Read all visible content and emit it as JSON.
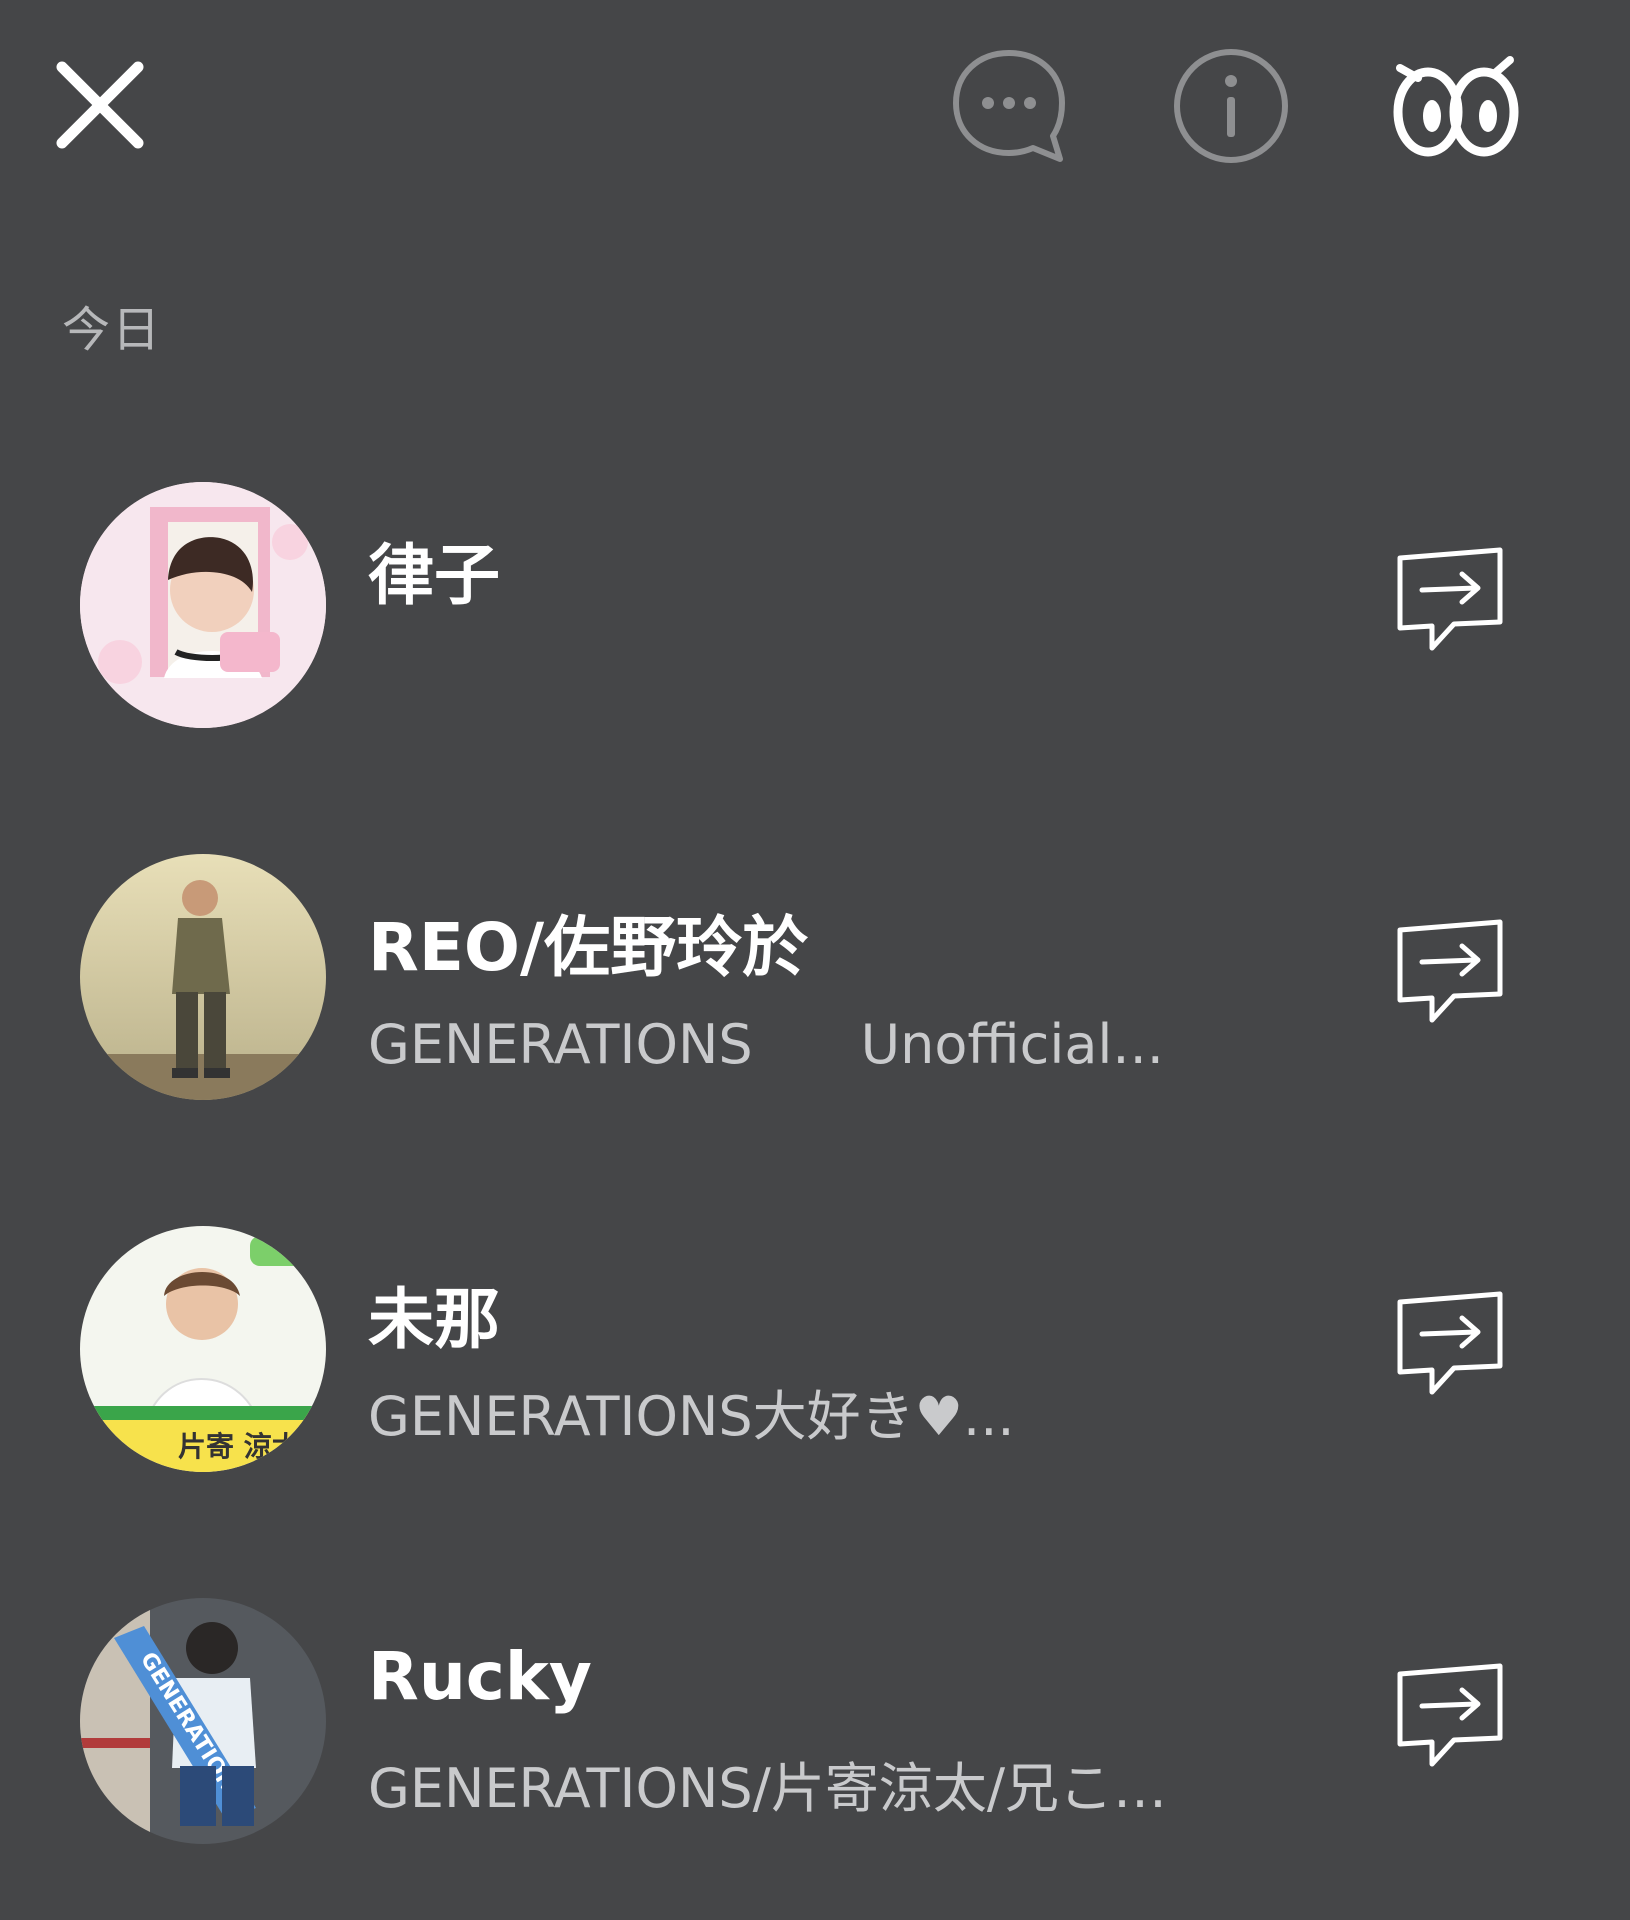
{
  "header": {
    "close_icon": "close-icon",
    "chat_icon": "chat-bubble-icon",
    "info_icon": "info-icon",
    "eyes_icon": "eyes-icon"
  },
  "section": {
    "label": "今日"
  },
  "friends": [
    {
      "name": "律子",
      "status": "",
      "avatar_icon": "avatar-photo",
      "action_icon": "share-message-icon"
    },
    {
      "name": "REO/佐野玲於",
      "status": "GENERATIONS　　Unofficial...",
      "avatar_icon": "avatar-photo",
      "action_icon": "share-message-icon"
    },
    {
      "name": "未那",
      "status": "GENERATIONS大好き♥...",
      "avatar_icon": "avatar-photo",
      "action_icon": "share-message-icon"
    },
    {
      "name": "Rucky",
      "status": "GENERATIONS/片寄涼太/兄こ…",
      "avatar_icon": "avatar-photo",
      "action_icon": "share-message-icon"
    }
  ],
  "colors": {
    "background": "#454648",
    "text_primary": "#ffffff",
    "text_secondary": "#c9cacc",
    "icon_muted": "#8e8f91"
  }
}
